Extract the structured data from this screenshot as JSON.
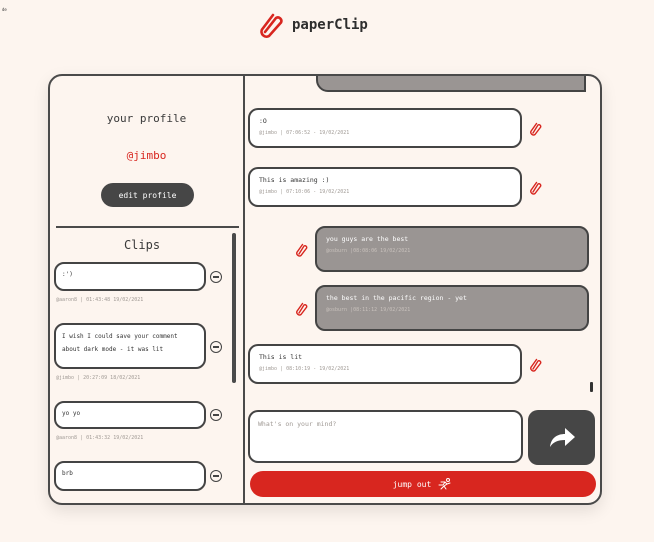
{
  "corner_text": "de",
  "brand": {
    "name": "paperClip",
    "icon": "paperclip-icon",
    "color": "#d8261f"
  },
  "profile": {
    "title": "your profile",
    "username": "@jimbo",
    "edit_label": "edit profile"
  },
  "clips": {
    "title": "Clips",
    "items": [
      {
        "text": ":')",
        "meta": "@aaron8 | 01:43:48 19/02/2021"
      },
      {
        "text": "I wish I could save your comment about dark mode - it was lit",
        "meta": "@jimbo | 20:27:09 18/02/2021"
      },
      {
        "text": "yo yo",
        "meta": "@aaron8 | 01:43:32 19/02/2021"
      },
      {
        "text": "brb",
        "meta": ""
      }
    ]
  },
  "messages": [
    {
      "text": ":O",
      "meta": "@jimbo | 07:06:52 - 19/02/2021",
      "mine": true
    },
    {
      "text": "This is amazing :)",
      "meta": "@jimbo | 07:10:06 - 19/02/2021",
      "mine": true
    },
    {
      "text": "you guys are the best",
      "meta": "@osburn |08:08:06 19/02/2021",
      "mine": false
    },
    {
      "text": "the best in the pacific region - yet",
      "meta": "@osburn |08:11:12 19/02/2021",
      "mine": false
    },
    {
      "text": "This is lit",
      "meta": "@jimbo | 08:10:19 - 19/02/2021",
      "mine": true
    }
  ],
  "compose": {
    "placeholder": "What's on your mind?"
  },
  "send": {
    "icon": "share-arrow-icon"
  },
  "jump": {
    "label": "jump out",
    "icon": "running-person-icon"
  }
}
